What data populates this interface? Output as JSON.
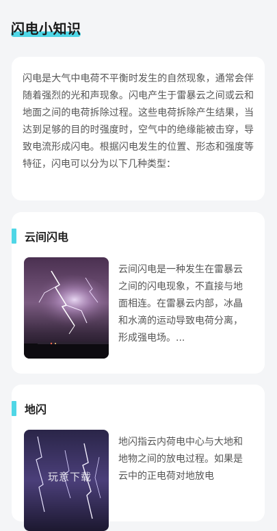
{
  "header": {
    "title": "闪电小知识"
  },
  "intro": {
    "text": "闪电是大气中电荷不平衡时发生的自然现象，通常会伴随着强烈的光和声现象。闪电产生于雷暴云之间或云和地面之间的电荷拆除过程。这些电荷拆除产生结果，当达到足够的目的时强度时，空气中的绝缘能被击穿，导致电流形成闪电。根据闪电发生的位置、形态和强度等特征，闪电可以分为以下几种类型："
  },
  "sections": [
    {
      "title": "云间闪电",
      "description": "云间闪电是一种发生在雷暴云之间的闪电现象，不直接与地面相连。在雷暴云内部，冰晶和水滴的运动导致电荷分离，形成强电场。...",
      "image_icon": "lightning-photo"
    },
    {
      "title": "地闪",
      "description": "地闪指云内荷电中心与大地和地物之间的放电过程。如果是云中的正电荷对地放电",
      "image_icon": "lightning-photo"
    }
  ],
  "watermark": {
    "text": "玩意下载"
  },
  "colors": {
    "accent": "#4fd6e6",
    "background": "#f4f5f7",
    "card": "#ffffff"
  }
}
